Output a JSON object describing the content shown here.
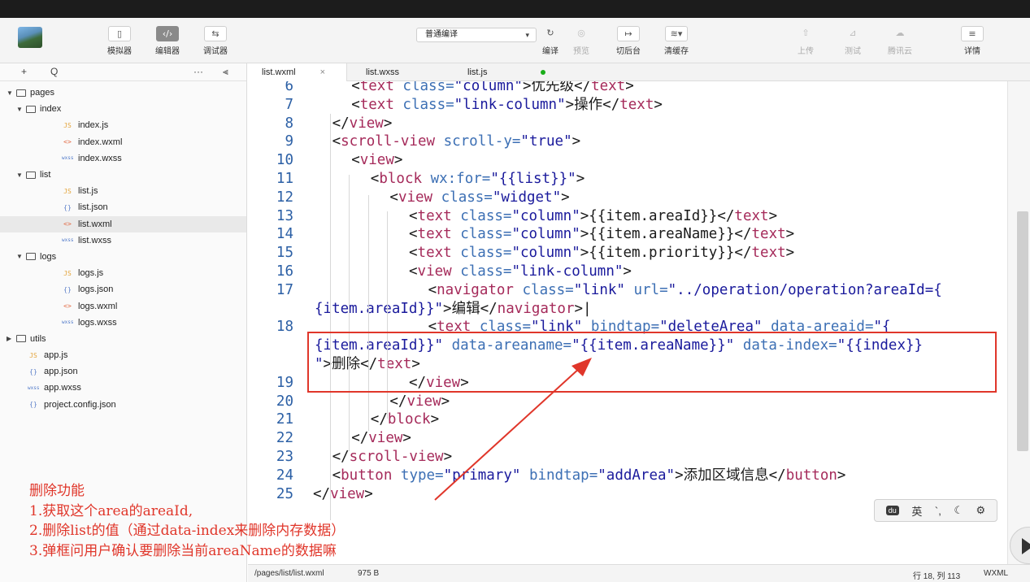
{
  "toolbar": {
    "simulator": "模拟器",
    "editor": "编辑器",
    "debugger": "调试器",
    "compile_mode": "普通编译",
    "compile": "编译",
    "preview": "预览",
    "background": "切后台",
    "clear_cache": "清缓存",
    "upload": "上传",
    "test": "测试",
    "tencent_cloud": "腾讯云",
    "details": "详情",
    "icons": {
      "simulator": "phone-icon",
      "editor": "code-icon",
      "debugger": "debug-icon",
      "compile": "refresh-icon",
      "preview": "eye-icon",
      "background": "switch-icon",
      "clear_cache": "layers-icon",
      "upload": "upload-icon",
      "test": "flask-icon",
      "tencent_cloud": "cloud-icon",
      "details": "menu-icon"
    }
  },
  "sidebar": {
    "add": "+",
    "search": "Q",
    "more": "···",
    "collapse": "⫷",
    "tree": [
      {
        "label": "pages",
        "type": "folder",
        "depth": 0
      },
      {
        "label": "index",
        "type": "folder",
        "depth": 1
      },
      {
        "label": "index.js",
        "type": "js",
        "icon": "JS",
        "depth": 2
      },
      {
        "label": "index.wxml",
        "type": "wxml",
        "icon": "<>",
        "depth": 2
      },
      {
        "label": "index.wxss",
        "type": "wxss",
        "icon": "wxss",
        "depth": 2
      },
      {
        "label": "list",
        "type": "folder",
        "depth": 1
      },
      {
        "label": "list.js",
        "type": "js",
        "icon": "JS",
        "depth": 2
      },
      {
        "label": "list.json",
        "type": "json",
        "icon": "{}",
        "depth": 2
      },
      {
        "label": "list.wxml",
        "type": "wxml",
        "icon": "<>",
        "depth": 2,
        "selected": true
      },
      {
        "label": "list.wxss",
        "type": "wxss",
        "icon": "wxss",
        "depth": 2
      },
      {
        "label": "logs",
        "type": "folder",
        "depth": 1
      },
      {
        "label": "logs.js",
        "type": "js",
        "icon": "JS",
        "depth": 2
      },
      {
        "label": "logs.json",
        "type": "json",
        "icon": "{}",
        "depth": 2
      },
      {
        "label": "logs.wxml",
        "type": "wxml",
        "icon": "<>",
        "depth": 2
      },
      {
        "label": "logs.wxss",
        "type": "wxss",
        "icon": "wxss",
        "depth": 2
      },
      {
        "label": "utils",
        "type": "folder-closed",
        "depth": 0
      },
      {
        "label": "app.js",
        "type": "js",
        "icon": "JS",
        "depth": 0
      },
      {
        "label": "app.json",
        "type": "json",
        "icon": "{}",
        "depth": 0
      },
      {
        "label": "app.wxss",
        "type": "wxss",
        "icon": "wxss",
        "depth": 0
      },
      {
        "label": "project.config.json",
        "type": "json",
        "icon": "{}",
        "depth": 0
      }
    ]
  },
  "tabs": [
    {
      "label": "list.wxml",
      "close": "×",
      "active": true
    },
    {
      "label": "list.wxss"
    },
    {
      "label": "list.js",
      "modified": true
    }
  ],
  "code": [
    {
      "n": "6",
      "segs": [
        [
          "tag",
          "<"
        ],
        [
          "tn",
          "text "
        ],
        [
          "at",
          "class="
        ],
        [
          "st",
          "\"column\""
        ],
        [
          "tag",
          ">"
        ],
        [
          "tx",
          "优先级"
        ],
        [
          "tag",
          "</"
        ],
        [
          "tn",
          "text"
        ],
        [
          "tag",
          ">"
        ]
      ],
      "indent": 2
    },
    {
      "n": "7",
      "segs": [
        [
          "tag",
          "<"
        ],
        [
          "tn",
          "text "
        ],
        [
          "at",
          "class="
        ],
        [
          "st",
          "\"link-column\""
        ],
        [
          "tag",
          ">"
        ],
        [
          "tx",
          "操作"
        ],
        [
          "tag",
          "</"
        ],
        [
          "tn",
          "text"
        ],
        [
          "tag",
          ">"
        ]
      ],
      "indent": 2
    },
    {
      "n": "8",
      "segs": [
        [
          "tag",
          "</"
        ],
        [
          "tn",
          "view"
        ],
        [
          "tag",
          ">"
        ]
      ],
      "indent": 1
    },
    {
      "n": "9",
      "segs": [
        [
          "tag",
          "<"
        ],
        [
          "tn",
          "scroll-view "
        ],
        [
          "at",
          "scroll-y="
        ],
        [
          "st",
          "\"true\""
        ],
        [
          "tag",
          ">"
        ]
      ],
      "indent": 1
    },
    {
      "n": "10",
      "segs": [
        [
          "tag",
          "<"
        ],
        [
          "tn",
          "view"
        ],
        [
          "tag",
          ">"
        ]
      ],
      "indent": 2
    },
    {
      "n": "11",
      "segs": [
        [
          "tag",
          "<"
        ],
        [
          "tn",
          "block "
        ],
        [
          "at",
          "wx:for="
        ],
        [
          "st",
          "\"{{list}}\""
        ],
        [
          "tag",
          ">"
        ]
      ],
      "indent": 3
    },
    {
      "n": "12",
      "segs": [
        [
          "tag",
          "<"
        ],
        [
          "tn",
          "view "
        ],
        [
          "at",
          "class="
        ],
        [
          "st",
          "\"widget\""
        ],
        [
          "tag",
          ">"
        ]
      ],
      "indent": 4
    },
    {
      "n": "13",
      "segs": [
        [
          "tag",
          "<"
        ],
        [
          "tn",
          "text "
        ],
        [
          "at",
          "class="
        ],
        [
          "st",
          "\"column\""
        ],
        [
          "tag",
          ">"
        ],
        [
          "tx",
          "{{item.areaId}}"
        ],
        [
          "tag",
          "</"
        ],
        [
          "tn",
          "text"
        ],
        [
          "tag",
          ">"
        ]
      ],
      "indent": 5
    },
    {
      "n": "14",
      "segs": [
        [
          "tag",
          "<"
        ],
        [
          "tn",
          "text "
        ],
        [
          "at",
          "class="
        ],
        [
          "st",
          "\"column\""
        ],
        [
          "tag",
          ">"
        ],
        [
          "tx",
          "{{item.areaName}}"
        ],
        [
          "tag",
          "</"
        ],
        [
          "tn",
          "text"
        ],
        [
          "tag",
          ">"
        ]
      ],
      "indent": 5
    },
    {
      "n": "15",
      "segs": [
        [
          "tag",
          "<"
        ],
        [
          "tn",
          "text "
        ],
        [
          "at",
          "class="
        ],
        [
          "st",
          "\"column\""
        ],
        [
          "tag",
          ">"
        ],
        [
          "tx",
          "{{item.priority}}"
        ],
        [
          "tag",
          "</"
        ],
        [
          "tn",
          "text"
        ],
        [
          "tag",
          ">"
        ]
      ],
      "indent": 5
    },
    {
      "n": "16",
      "segs": [
        [
          "tag",
          "<"
        ],
        [
          "tn",
          "view "
        ],
        [
          "at",
          "class="
        ],
        [
          "st",
          "\"link-column\""
        ],
        [
          "tag",
          ">"
        ]
      ],
      "indent": 5
    },
    {
      "n": "17",
      "segs": [
        [
          "tag",
          "<"
        ],
        [
          "tn",
          "navigator "
        ],
        [
          "at",
          "class="
        ],
        [
          "st",
          "\"link\" "
        ],
        [
          "at",
          "url="
        ],
        [
          "st",
          "\"../operation/operation?areaId={"
        ]
      ],
      "indent": 6
    },
    {
      "n": "",
      "segs": [
        [
          "st",
          "{item.areaId}}\""
        ],
        [
          "tag",
          ">"
        ],
        [
          "tx",
          "编辑"
        ],
        [
          "tag",
          "</"
        ],
        [
          "tn",
          "navigator"
        ],
        [
          "tag",
          ">"
        ],
        [
          "tx",
          "|"
        ]
      ],
      "indent": 0
    },
    {
      "n": "18",
      "segs": [
        [
          "tag",
          "<"
        ],
        [
          "tn",
          "text "
        ],
        [
          "at",
          "class="
        ],
        [
          "st",
          "\"link\" "
        ],
        [
          "at",
          "bindtap="
        ],
        [
          "st",
          "\"deleteArea\" "
        ],
        [
          "at",
          "data-areaid="
        ],
        [
          "st",
          "\"{"
        ]
      ],
      "indent": 6
    },
    {
      "n": "",
      "segs": [
        [
          "st",
          "{item.areaId}}\" "
        ],
        [
          "at",
          "data-areaname="
        ],
        [
          "st",
          "\"{{item.areaName}}\" "
        ],
        [
          "at",
          "data-index="
        ],
        [
          "st",
          "\"{{index}}"
        ]
      ],
      "indent": 0
    },
    {
      "n": "",
      "segs": [
        [
          "st",
          "\""
        ],
        [
          "tag",
          ">"
        ],
        [
          "tx",
          "删除"
        ],
        [
          "tag",
          "</"
        ],
        [
          "tn",
          "text"
        ],
        [
          "tag",
          ">"
        ]
      ],
      "indent": 0
    },
    {
      "n": "19",
      "segs": [
        [
          "tag",
          "</"
        ],
        [
          "tn",
          "view"
        ],
        [
          "tag",
          ">"
        ]
      ],
      "indent": 5
    },
    {
      "n": "20",
      "segs": [
        [
          "tag",
          "</"
        ],
        [
          "tn",
          "view"
        ],
        [
          "tag",
          ">"
        ]
      ],
      "indent": 4
    },
    {
      "n": "21",
      "segs": [
        [
          "tag",
          "</"
        ],
        [
          "tn",
          "block"
        ],
        [
          "tag",
          ">"
        ]
      ],
      "indent": 3
    },
    {
      "n": "22",
      "segs": [
        [
          "tag",
          "</"
        ],
        [
          "tn",
          "view"
        ],
        [
          "tag",
          ">"
        ]
      ],
      "indent": 2
    },
    {
      "n": "23",
      "segs": [
        [
          "tag",
          "</"
        ],
        [
          "tn",
          "scroll-view"
        ],
        [
          "tag",
          ">"
        ]
      ],
      "indent": 1
    },
    {
      "n": "24",
      "segs": [
        [
          "tag",
          "<"
        ],
        [
          "tn",
          "button "
        ],
        [
          "at",
          "type="
        ],
        [
          "st",
          "\"primary\" "
        ],
        [
          "at",
          "bindtap="
        ],
        [
          "st",
          "\"addArea\""
        ],
        [
          "tag",
          ">"
        ],
        [
          "tx",
          "添加区域信息"
        ],
        [
          "tag",
          "</"
        ],
        [
          "tn",
          "button"
        ],
        [
          "tag",
          ">"
        ]
      ],
      "indent": 1
    },
    {
      "n": "25",
      "segs": [
        [
          "tag",
          "</"
        ],
        [
          "tn",
          "view"
        ],
        [
          "tag",
          ">"
        ]
      ],
      "indent": 0
    }
  ],
  "notes": [
    "删除功能",
    "1.获取这个area的areaId,",
    "2.删除list的值（通过data-index来删除内存数据）",
    "3.弹框问用户确认要删除当前areaName的数据嘛"
  ],
  "ime": {
    "logo": "du",
    "lang": "英",
    "punct": "`,",
    "moon": "☾",
    "settings": "⚙"
  },
  "statusbar": {
    "path": "/pages/list/list.wxml",
    "size": "975 B",
    "position": "行 18, 列 113",
    "lang": "WXML"
  },
  "colors": {
    "annotation": "#e0362a",
    "tag_name": "#a52a5a",
    "attr": "#3c6fb4",
    "string": "#1a1a9c",
    "line_number": "#2b5fa5"
  }
}
